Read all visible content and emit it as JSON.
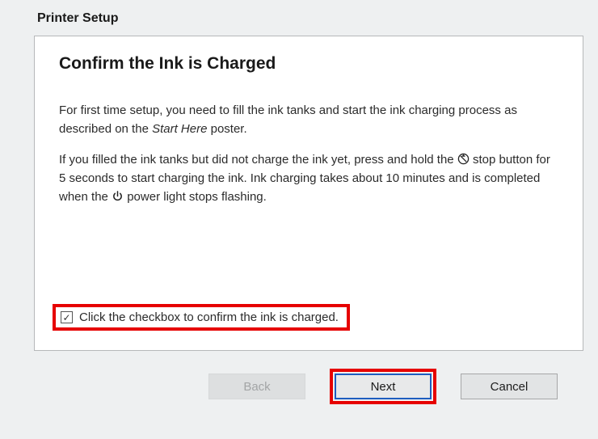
{
  "window": {
    "title": "Printer Setup"
  },
  "main": {
    "heading": "Confirm the Ink is Charged",
    "para1_a": "For first time setup, you need to fill the ink tanks and start the ink charging process as described on the ",
    "para1_em": "Start Here",
    "para1_b": " poster.",
    "para2_a": "If you filled the ink tanks but did not charge the ink yet, press and hold the ",
    "para2_b": " stop button for 5 seconds to start charging the ink. Ink charging takes about 10 minutes and is completed when the ",
    "para2_c": " power light stops flashing."
  },
  "confirm": {
    "checked": true,
    "label": "Click the checkbox to confirm the ink is charged."
  },
  "buttons": {
    "back": "Back",
    "next": "Next",
    "cancel": "Cancel"
  }
}
